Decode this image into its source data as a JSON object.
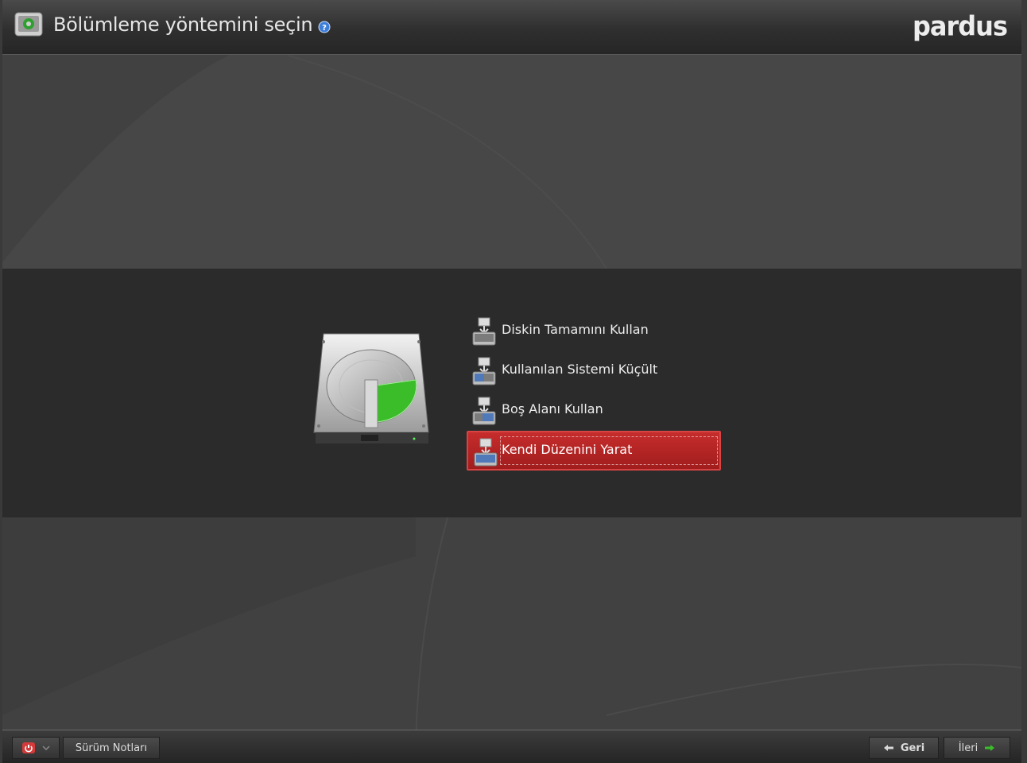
{
  "header": {
    "title": "Bölümleme yöntemini seçin",
    "logo": "pardus",
    "app_icon": "installer-icon",
    "help_icon": "help-icon"
  },
  "options": [
    {
      "label": "Diskin Tamamını Kullan",
      "icon": "disk-full-icon",
      "selected": false
    },
    {
      "label": "Kullanılan Sistemi Küçült",
      "icon": "disk-shrink-icon",
      "selected": false
    },
    {
      "label": "Boş Alanı Kullan",
      "icon": "disk-free-space-icon",
      "selected": false
    },
    {
      "label": "Kendi Düzenini Yarat",
      "icon": "disk-custom-icon",
      "selected": true
    }
  ],
  "footer": {
    "release_notes_label": "Sürüm Notları",
    "back_label": "Geri",
    "next_label": "İleri"
  },
  "colors": {
    "selection": "#b52424",
    "accent_green": "#3bbd2a",
    "background": "#414141"
  }
}
